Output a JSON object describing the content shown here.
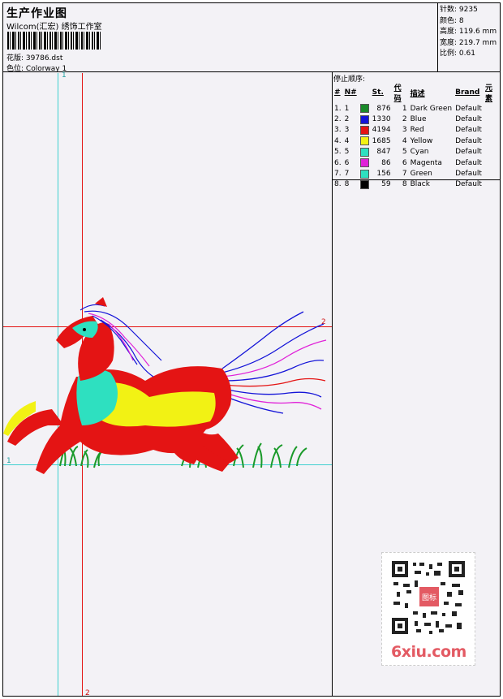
{
  "header": {
    "title": "生产作业图",
    "software": "Wilcom(汇宏) 绣饰工作室",
    "design_label": "花版:",
    "design_value": "39786.dst",
    "colorway_label": "色位:",
    "colorway_value": "Colorway 1"
  },
  "stats": {
    "stitches_label": "针数:",
    "stitches_value": "9235",
    "colors_label": "颜色:",
    "colors_value": "8",
    "height_label": "高度:",
    "height_value": "119.6 mm",
    "width_label": "宽度:",
    "width_value": "219.7 mm",
    "scale_label": "比例:",
    "scale_value": "0.61"
  },
  "stop_sequence": {
    "title": "停止顺序:",
    "columns": [
      "#",
      "N#",
      "",
      "St.",
      "代码",
      "描述",
      "Brand",
      "元素"
    ],
    "rows": [
      {
        "idx": "1.",
        "n": "1",
        "color": "#1a8a2a",
        "st": "876",
        "code": "1",
        "desc": "Dark Green",
        "brand": "Default"
      },
      {
        "idx": "2.",
        "n": "2",
        "color": "#1414d8",
        "st": "1330",
        "code": "2",
        "desc": "Blue",
        "brand": "Default"
      },
      {
        "idx": "3.",
        "n": "3",
        "color": "#e41414",
        "st": "4194",
        "code": "3",
        "desc": "Red",
        "brand": "Default"
      },
      {
        "idx": "4.",
        "n": "4",
        "color": "#f2f214",
        "st": "1685",
        "code": "4",
        "desc": "Yellow",
        "brand": "Default"
      },
      {
        "idx": "5.",
        "n": "5",
        "color": "#2ee0c0",
        "st": "847",
        "code": "5",
        "desc": "Cyan",
        "brand": "Default"
      },
      {
        "idx": "6.",
        "n": "6",
        "color": "#e020d8",
        "st": "86",
        "code": "6",
        "desc": "Magenta",
        "brand": "Default"
      },
      {
        "idx": "7.",
        "n": "7",
        "color": "#2ee0c0",
        "st": "156",
        "code": "7",
        "desc": "Green",
        "brand": "Default"
      },
      {
        "idx": "8.",
        "n": "8",
        "color": "#000000",
        "st": "59",
        "code": "8",
        "desc": "Black",
        "brand": "Default"
      }
    ]
  },
  "guides": {
    "v1_label": "1",
    "v2_label": "2",
    "h1_label": "1",
    "h2_label": "2",
    "cyan": "#40d0d0",
    "red": "#e41414"
  },
  "watermark": {
    "text": "6xiu.com",
    "stamp": "图标"
  }
}
